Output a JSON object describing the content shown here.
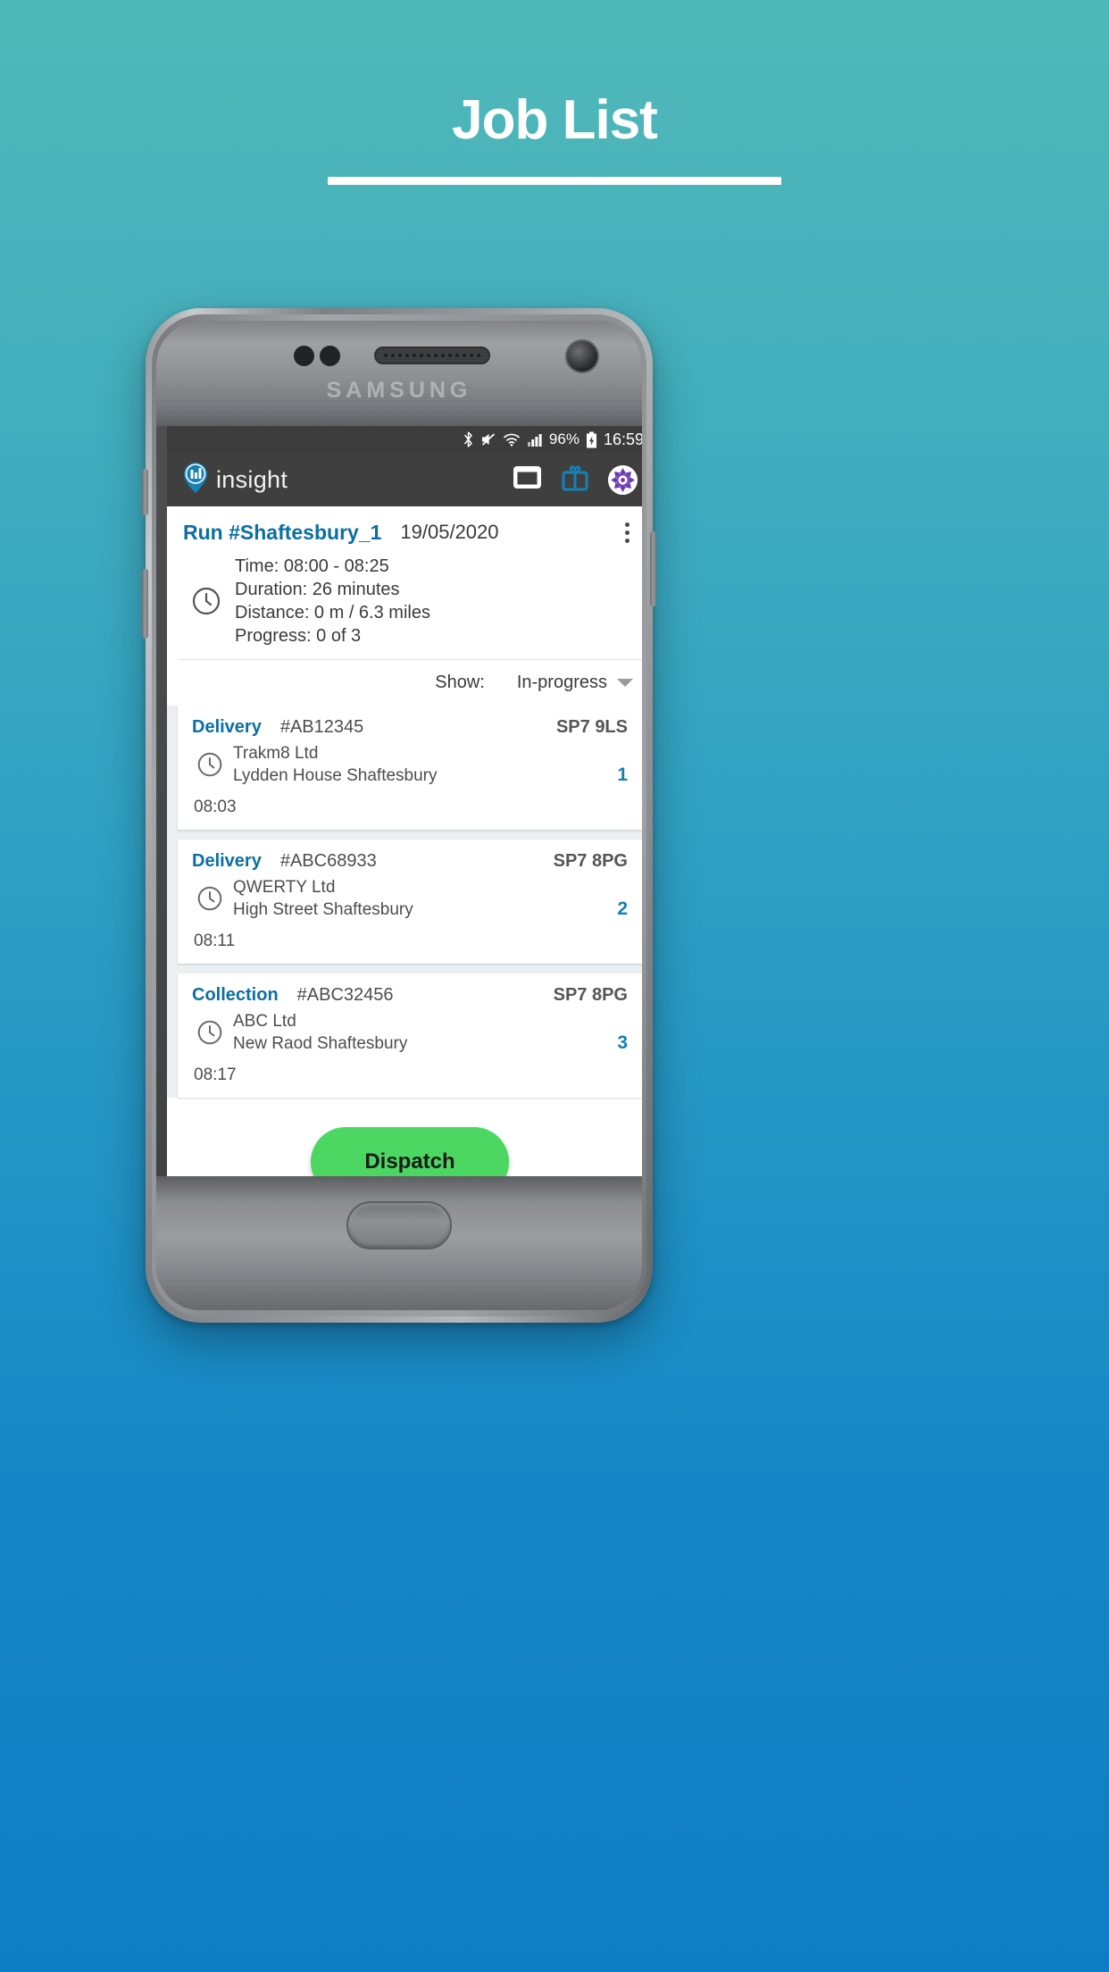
{
  "page": {
    "title": "Job List",
    "background_top_color": "#4fb8b8",
    "background_bottom_color": "#0f7dc4"
  },
  "device": {
    "brand": "SAMSUNG"
  },
  "statusbar": {
    "icons": [
      "bluetooth-icon",
      "mute-icon",
      "wifi-icon",
      "signal-icon"
    ],
    "battery_percent": "96%",
    "battery_state": "charging",
    "time": "16:59"
  },
  "appbar": {
    "logo_text": "insight",
    "logo_icon": "map-pin-chart-icon",
    "icons": [
      {
        "name": "window-icon",
        "color": "#ffffff"
      },
      {
        "name": "gift-icon",
        "color": "#1581b5"
      },
      {
        "name": "avatar-icon",
        "color": "#6a3ab2"
      }
    ]
  },
  "run": {
    "id": "Run #Shaftesbury_1",
    "date": "19/05/2020",
    "menu_icon": "kebab-menu-icon",
    "clock_icon": "clock-icon",
    "time": "Time: 08:00 - 08:25",
    "duration": "Duration: 26 minutes",
    "distance": "Distance: 0 m / 6.3 miles",
    "progress": "Progress: 0 of 3",
    "accent_color": "#0b6fa4"
  },
  "filter": {
    "label": "Show:",
    "value": "In-progress",
    "caret_icon": "chevron-down-icon"
  },
  "jobs": [
    {
      "type": "Delivery",
      "reference": "#AB12345",
      "postcode": "SP7 9LS",
      "company": "Trakm8 Ltd",
      "address": "Lydden House Shaftesbury",
      "sequence": "1",
      "time": "08:03",
      "clock_icon": "clock-icon"
    },
    {
      "type": "Delivery",
      "reference": "#ABC68933",
      "postcode": "SP7 8PG",
      "company": "QWERTY Ltd",
      "address": "High Street Shaftesbury",
      "sequence": "2",
      "time": "08:11",
      "clock_icon": "clock-icon"
    },
    {
      "type": "Collection",
      "reference": "#ABC32456",
      "postcode": "SP7 8PG",
      "company": "ABC Ltd",
      "address": "New Raod Shaftesbury",
      "sequence": "3",
      "time": "08:17",
      "clock_icon": "clock-icon"
    }
  ],
  "dispatch": {
    "label": "Dispatch",
    "color": "#4bd762"
  }
}
